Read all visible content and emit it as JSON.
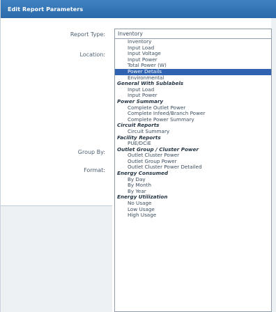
{
  "dialog": {
    "title": "Edit Report Parameters"
  },
  "form": {
    "report_type_label": "Report Type:",
    "location_label": "Location:",
    "group_by_label": "Group By:",
    "format_label": "Format:",
    "report_type_value": "Inventory"
  },
  "dropdown": {
    "options": [
      {
        "kind": "item",
        "label": "Inventory",
        "selected": false
      },
      {
        "kind": "item",
        "label": "Input Load",
        "selected": false
      },
      {
        "kind": "item",
        "label": "Input Voltage",
        "selected": false
      },
      {
        "kind": "item",
        "label": "Input Power",
        "selected": false
      },
      {
        "kind": "item",
        "label": "Total Power (W)",
        "selected": false
      },
      {
        "kind": "item",
        "label": "Power Details",
        "selected": true
      },
      {
        "kind": "item",
        "label": "Environmental",
        "selected": false
      },
      {
        "kind": "group",
        "label": "General With Sublabels",
        "selected": false
      },
      {
        "kind": "item",
        "label": "Input Load",
        "selected": false
      },
      {
        "kind": "item",
        "label": "Input Power",
        "selected": false
      },
      {
        "kind": "group",
        "label": "Power Summary",
        "selected": false
      },
      {
        "kind": "item",
        "label": "Complete Outlet Power",
        "selected": false
      },
      {
        "kind": "item",
        "label": "Complete Infeed/Branch Power",
        "selected": false
      },
      {
        "kind": "item",
        "label": "Complete Power Summary",
        "selected": false
      },
      {
        "kind": "group",
        "label": "Circuit Reports",
        "selected": false
      },
      {
        "kind": "item",
        "label": "Circuit Summary",
        "selected": false
      },
      {
        "kind": "group",
        "label": "Facility Reports",
        "selected": false
      },
      {
        "kind": "item",
        "label": "PUE/DCiE",
        "selected": false
      },
      {
        "kind": "group",
        "label": "Outlet Group / Cluster Power",
        "selected": false
      },
      {
        "kind": "item",
        "label": "Outlet Cluster Power",
        "selected": false
      },
      {
        "kind": "item",
        "label": "Outlet Group Power",
        "selected": false
      },
      {
        "kind": "item",
        "label": "Outlet Cluster Power Detailed",
        "selected": false
      },
      {
        "kind": "group",
        "label": "Energy Consumed",
        "selected": false
      },
      {
        "kind": "item",
        "label": "By Day",
        "selected": false
      },
      {
        "kind": "item",
        "label": "By Month",
        "selected": false
      },
      {
        "kind": "item",
        "label": "By Year",
        "selected": false
      },
      {
        "kind": "group",
        "label": "Energy Utilization",
        "selected": false
      },
      {
        "kind": "item",
        "label": "No Usage",
        "selected": false
      },
      {
        "kind": "item",
        "label": "Low Usage",
        "selected": false
      },
      {
        "kind": "item",
        "label": "High Usage",
        "selected": false
      }
    ]
  },
  "colors": {
    "title_bar": "#2f6fb1",
    "selected_row": "#2f62b0"
  }
}
